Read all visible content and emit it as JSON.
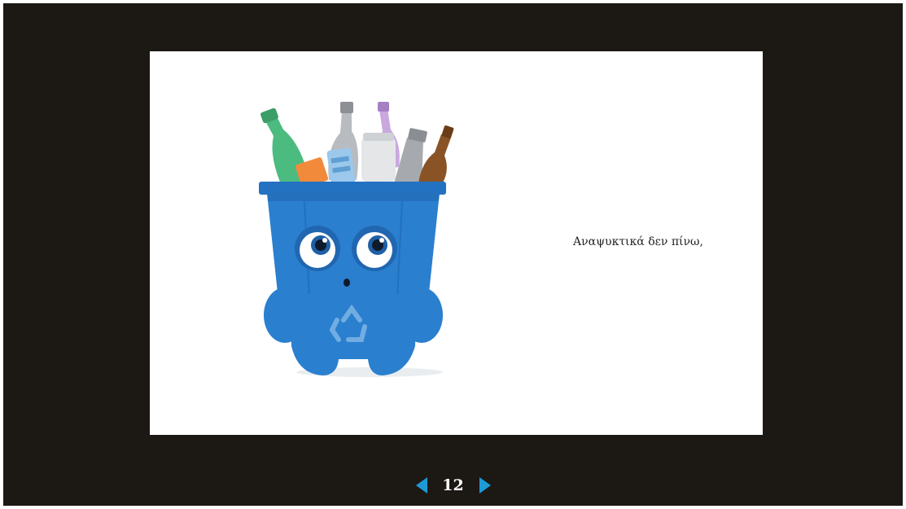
{
  "slide": {
    "text": "Αναψυκτικά δεν πίνω,",
    "illustration": "recycling-bin-character-with-bottles"
  },
  "pager": {
    "page_number": "12",
    "prev_icon": "triangle-left-icon",
    "next_icon": "triangle-right-icon"
  },
  "colors": {
    "background": "#1c1814",
    "slide": "#ffffff",
    "bin_blue": "#2a7fcf",
    "arrow_blue": "#1d9ad6",
    "page_number": "#ffffff"
  }
}
